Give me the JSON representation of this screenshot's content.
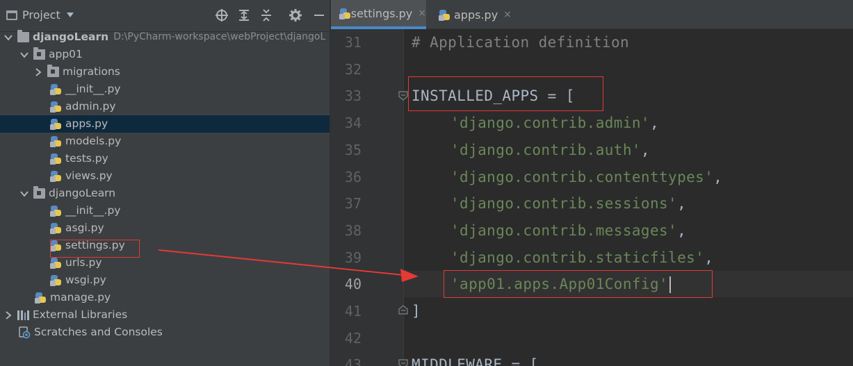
{
  "project_panel": {
    "title": "Project",
    "tree": [
      {
        "label": "djangoLearn",
        "path": "D:\\PyCharm-workspace\\webProject\\djangoL"
      },
      {
        "label": "app01"
      },
      {
        "label": "migrations"
      },
      {
        "label": "__init__.py"
      },
      {
        "label": "admin.py"
      },
      {
        "label": "apps.py"
      },
      {
        "label": "models.py"
      },
      {
        "label": "tests.py"
      },
      {
        "label": "views.py"
      },
      {
        "label": "djangoLearn"
      },
      {
        "label": "__init__.py"
      },
      {
        "label": "asgi.py"
      },
      {
        "label": "settings.py"
      },
      {
        "label": "urls.py"
      },
      {
        "label": "wsgi.py"
      },
      {
        "label": "manage.py"
      },
      {
        "label": "External Libraries"
      },
      {
        "label": "Scratches and Consoles"
      }
    ]
  },
  "tabs": [
    {
      "label": "settings.py",
      "close": "×"
    },
    {
      "label": "apps.py",
      "close": "×"
    }
  ],
  "editor": {
    "lines": [
      {
        "num": "31",
        "text": "# Application definition"
      },
      {
        "num": "32",
        "text": ""
      },
      {
        "num": "33",
        "text": "INSTALLED_APPS = ["
      },
      {
        "num": "34",
        "text": "'django.contrib.admin'",
        "suffix": ","
      },
      {
        "num": "35",
        "text": "'django.contrib.auth'",
        "suffix": ","
      },
      {
        "num": "36",
        "text": "'django.contrib.contenttypes'",
        "suffix": ","
      },
      {
        "num": "37",
        "text": "'django.contrib.sessions'",
        "suffix": ","
      },
      {
        "num": "38",
        "text": "'django.contrib.messages'",
        "suffix": ","
      },
      {
        "num": "39",
        "text": "'django.contrib.staticfiles'",
        "suffix": ","
      },
      {
        "num": "40",
        "text": "'app01.apps.App01Config'"
      },
      {
        "num": "41",
        "text": "]"
      },
      {
        "num": "42",
        "text": ""
      },
      {
        "num": "43",
        "text": "MIDDLEWARE = ["
      }
    ]
  },
  "colors": {
    "annotation": "#e53935",
    "selection": "#0d293e",
    "string": "#6a8759",
    "comment": "#808080"
  }
}
